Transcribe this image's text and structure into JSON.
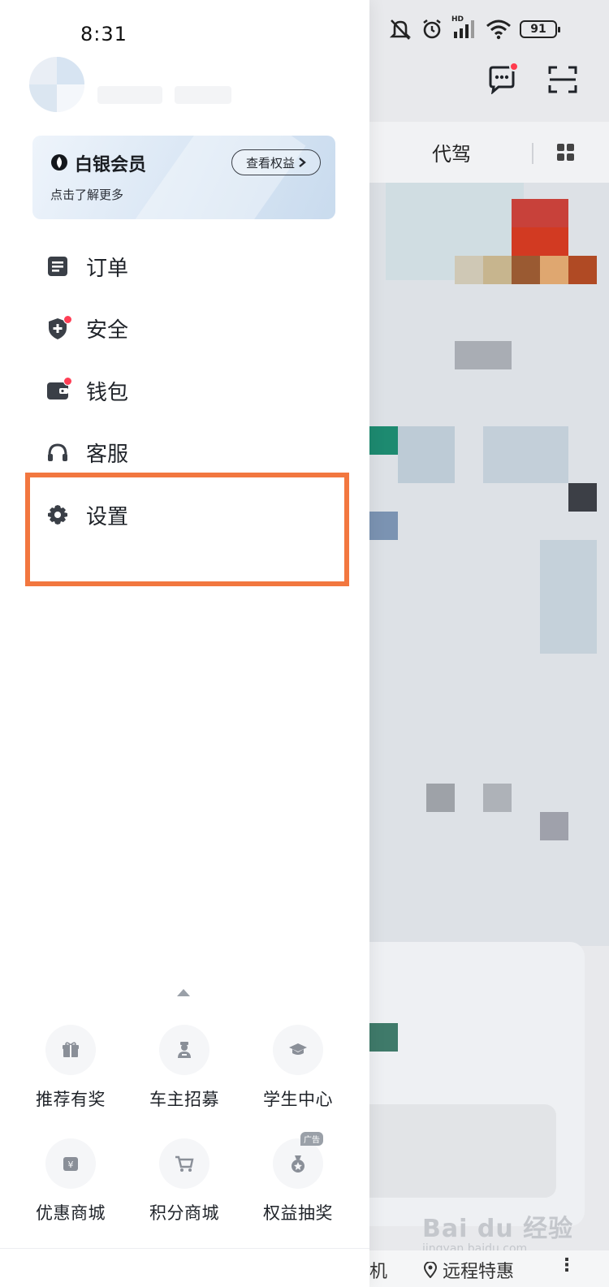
{
  "status_bar": {
    "time": "8:31",
    "battery": "91",
    "network_badge": "HD"
  },
  "background_app": {
    "tab_label": "代驾",
    "bottom_nav": {
      "partial_label": "机",
      "remote_label": "远程特惠",
      "more_label": "⋮"
    },
    "watermark": {
      "main": "Bai du 经验",
      "sub": "jingyan.baidu.com"
    }
  },
  "drawer": {
    "member": {
      "title": "白银会员",
      "subtitle": "点击了解更多",
      "benefit_button": "查看权益"
    },
    "menu": [
      {
        "label": "订单",
        "icon": "order-icon",
        "badge": false
      },
      {
        "label": "安全",
        "icon": "shield-plus-icon",
        "badge": true
      },
      {
        "label": "钱包",
        "icon": "wallet-icon",
        "badge": true
      },
      {
        "label": "客服",
        "icon": "headset-icon",
        "badge": false
      },
      {
        "label": "设置",
        "icon": "gear-icon",
        "badge": false
      }
    ],
    "services": [
      {
        "label": "推荐有奖",
        "icon": "gift-icon"
      },
      {
        "label": "车主招募",
        "icon": "driver-icon"
      },
      {
        "label": "学生中心",
        "icon": "graduation-cap-icon"
      },
      {
        "label": "优惠商城",
        "icon": "yen-bag-icon"
      },
      {
        "label": "积分商城",
        "icon": "cart-icon"
      },
      {
        "label": "权益抽奖",
        "icon": "lottery-bag-icon",
        "ad": "广告"
      }
    ]
  },
  "colors": {
    "highlight": "#f2773f",
    "badge_red": "#ff3e55",
    "icon_dark": "#3a3f47"
  }
}
